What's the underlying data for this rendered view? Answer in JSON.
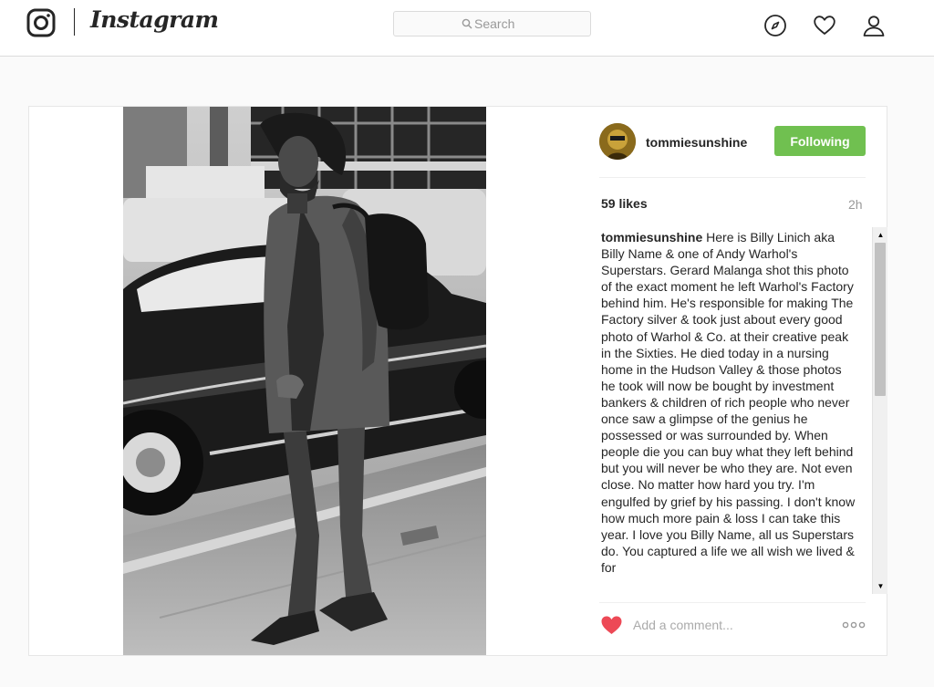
{
  "header": {
    "logo_text": "Instagram",
    "search_placeholder": "Search"
  },
  "nav": {
    "icons": [
      "explore-icon",
      "heart-icon",
      "profile-icon"
    ]
  },
  "post": {
    "username": "tommiesunshine",
    "follow_label": "Following",
    "likes": "59 likes",
    "time": "2h",
    "caption_username": "tommiesunshine",
    "caption_text": "Here is Billy Linich aka Billy Name & one of Andy Warhol's Superstars. Gerard Malanga shot this photo of the exact moment he left Warhol's Factory behind him. He's responsible for making The Factory silver & took just about every good photo of Warhol & Co. at their creative peak in the Sixties. He died today in a nursing home in the Hudson Valley & those photos he took will now be bought by investment bankers & children of rich people who never once saw a glimpse of the genius he possessed or was surrounded by. When people die you can buy what they left behind but you will never be who they are. Not even close. No matter how hard you try. I'm engulfed by grief by his passing. I don't know how much more pain & loss I can take this year. I love you Billy Name, all us Superstars do. You captured a life we all wish we lived & for",
    "comment_placeholder": "Add a comment...",
    "photo_alt": ""
  },
  "colors": {
    "follow_button": "#70c050",
    "like_heart": "#ed4956",
    "muted_text": "#999999",
    "border": "#dbdbdb"
  }
}
